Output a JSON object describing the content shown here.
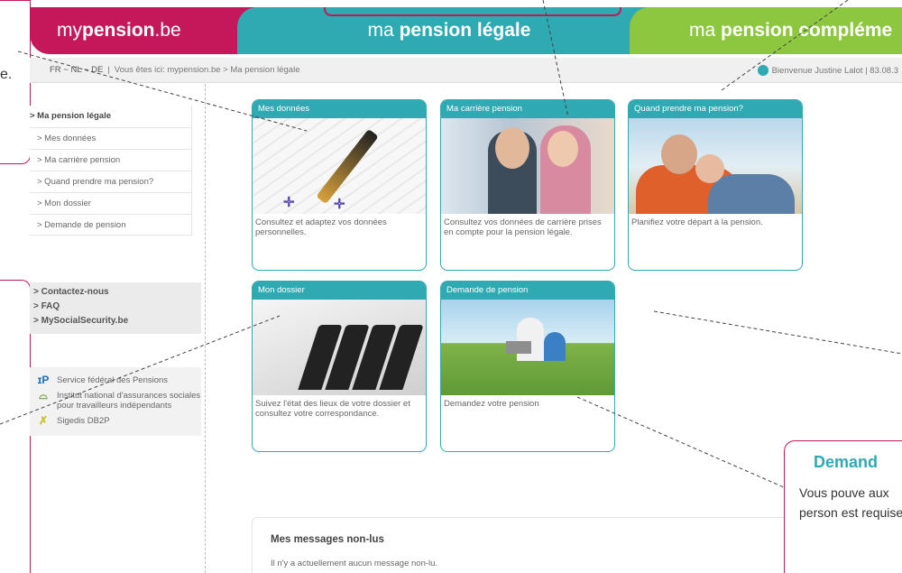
{
  "header": {
    "logo_light": "my",
    "logo_bold": "pension",
    "logo_tail": ".be",
    "legal_light": "ma ",
    "legal_bold": "pension légale",
    "comp_light": "ma ",
    "comp_bold": "pension compléme"
  },
  "callout_left": {
    "fragment": "e."
  },
  "breadcrumb": {
    "languages": "FR ~ NL ~ DE",
    "separator": "|",
    "path": "Vous êtes ici: mypension.be > Ma pension légale",
    "welcome": "Bienvenue Justine Lalot | 83.08.3"
  },
  "sidebar": {
    "heading": "> Ma pension légale",
    "items": [
      {
        "label": "> Mes données"
      },
      {
        "label": "> Ma carrière pension"
      },
      {
        "label": "> Quand prendre ma pension?"
      },
      {
        "label": "> Mon dossier"
      },
      {
        "label": "> Demande de pension"
      }
    ],
    "links": [
      {
        "label": "> Contactez-nous"
      },
      {
        "label": "> FAQ"
      },
      {
        "label": "> MySocialSecurity.be"
      }
    ],
    "partners": [
      {
        "icon": "sfp-logo",
        "label": "Service fédéral des Pensions"
      },
      {
        "icon": "inasti-logo",
        "label": "Institut national d'assurances sociales pour travailleurs indépendants"
      },
      {
        "icon": "sigedis-logo",
        "label": "Sigedis DB2P"
      }
    ]
  },
  "tiles": [
    {
      "title": "Mes données",
      "text": "Consultez et adaptez vos données personnelles."
    },
    {
      "title": "Ma carrière pension",
      "text": "Consultez vos données de carrière prises en compte pour la pension légale."
    },
    {
      "title": "Quand prendre ma pension?",
      "text": "Planifiez votre départ à la pension."
    },
    {
      "title": "Mon dossier",
      "text": "Suivez l'état des lieux de votre dossier et consultez votre correspondance."
    },
    {
      "title": "Demande de pension",
      "text": "Demandez votre pension"
    }
  ],
  "messages": {
    "title": "Mes messages non-lus",
    "text": "Il n'y a actuellement aucun message non-lu."
  },
  "callout_right": {
    "title": "Demand",
    "text": "Vous pouve aux person est requise"
  },
  "colors": {
    "brand_magenta": "#c5185a",
    "brand_teal": "#2fa9b2",
    "brand_green": "#8dc63f"
  }
}
